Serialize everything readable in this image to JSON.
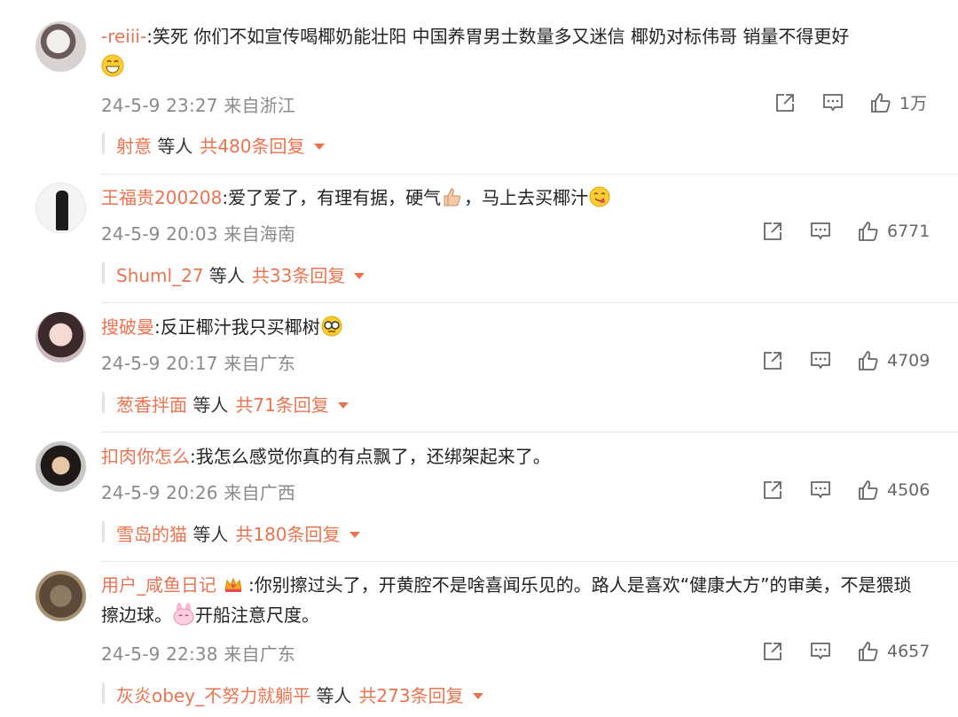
{
  "comments": [
    {
      "username": "-reiii-",
      "content": ":笑死 你们不如宣传喝椰奶能壮阳 中国养胃男士数量多又迷信 椰奶对标伟哥 销量不得更好",
      "time": "24-5-9 23:27",
      "location": "来自浙江",
      "likes": "1万",
      "reply_user": "射意",
      "reply_mid": "等人",
      "reply_total": "共480条回复",
      "emoji_icon": "grin-emoji-icon"
    },
    {
      "username": "王福贵200208",
      "content": ":爱了爱了，有理有据，硬气",
      "content_tail": "，马上去买椰汁",
      "time": "24-5-9 20:03",
      "location": "来自海南",
      "likes": "6771",
      "reply_user": "Shuml_27",
      "reply_mid": "等人",
      "reply_total": "共33条回复"
    },
    {
      "username": "搜破曼",
      "content": ":反正椰汁我只买椰树",
      "time": "24-5-9 20:17",
      "location": "来自广东",
      "likes": "4709",
      "reply_user": "葱香拌面",
      "reply_mid": "等人",
      "reply_total": "共71条回复"
    },
    {
      "username": "扣肉你怎么",
      "content": ":我怎么感觉你真的有点飘了，还绑架起来了。",
      "time": "24-5-9 20:26",
      "location": "来自广西",
      "likes": "4506",
      "reply_user": "雪岛的猫",
      "reply_mid": "等人",
      "reply_total": "共180条回复"
    },
    {
      "username": "用户_咸鱼日记",
      "content": ":你别擦过头了，开黄腔不是啥喜闻乐见的。路人是喜欢“健康大方”的审美，不是猥琐擦边球。",
      "content_tail": "开船注意尺度。",
      "time": "24-5-9 22:38",
      "location": "来自广东",
      "likes": "4657",
      "reply_user": "灰炎obey_不努力就躺平",
      "reply_mid": "等人",
      "reply_total": "共273条回复"
    }
  ]
}
